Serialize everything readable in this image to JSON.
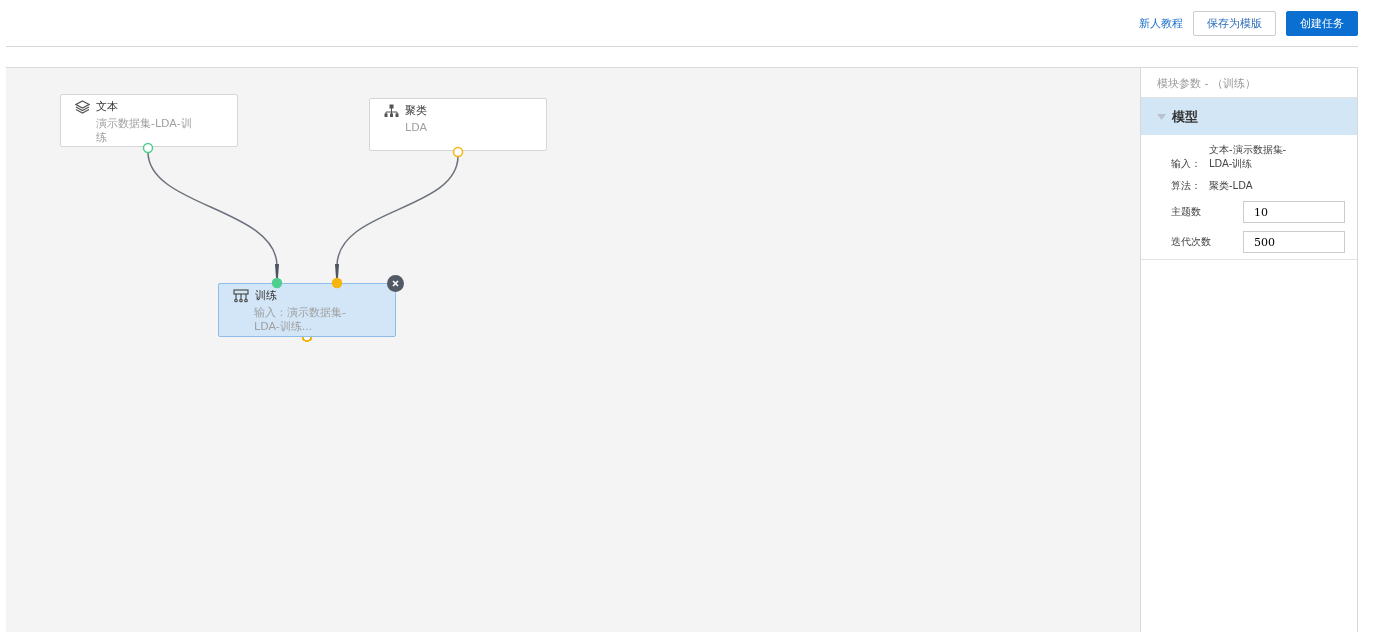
{
  "toolbar": {
    "link": "新人教程",
    "buttons": [
      {
        "label": "保存为模版",
        "kind": "secondary"
      },
      {
        "label": "创建任务",
        "kind": "primary"
      }
    ]
  },
  "canvas": {
    "nodes": [
      {
        "title": "文本",
        "subtitle": "演示数据集-LDA-训练",
        "selected": false,
        "deletable": false,
        "ports": [
          {
            "color": "#4fcf8f",
            "filled": false
          }
        ]
      },
      {
        "title": "聚类",
        "subtitle": "LDA",
        "selected": false,
        "deletable": false,
        "ports": [
          {
            "color": "#f5b50f",
            "filled": false
          }
        ]
      },
      {
        "title": "训练",
        "subtitle": "输入：演示数据集-LDA-训练...",
        "selected": true,
        "deletable": true,
        "ports": [
          {
            "color": "#4fcf8f",
            "filled": true
          },
          {
            "color": "#f5b50f",
            "filled": true
          },
          {
            "color": "#f5b50f",
            "filled": false
          }
        ]
      }
    ]
  },
  "panel": {
    "title": "模块参数 - （训练）",
    "section": {
      "title": "模型",
      "expanded": true,
      "info": [
        {
          "label": "输入：",
          "value": "文本-演示数据集-LDA-训练"
        },
        {
          "label": "算法：",
          "value": "聚类-LDA"
        }
      ],
      "fields": [
        {
          "label": "主题数",
          "value": "10"
        },
        {
          "label": "迭代次数",
          "value": "500"
        }
      ]
    }
  }
}
